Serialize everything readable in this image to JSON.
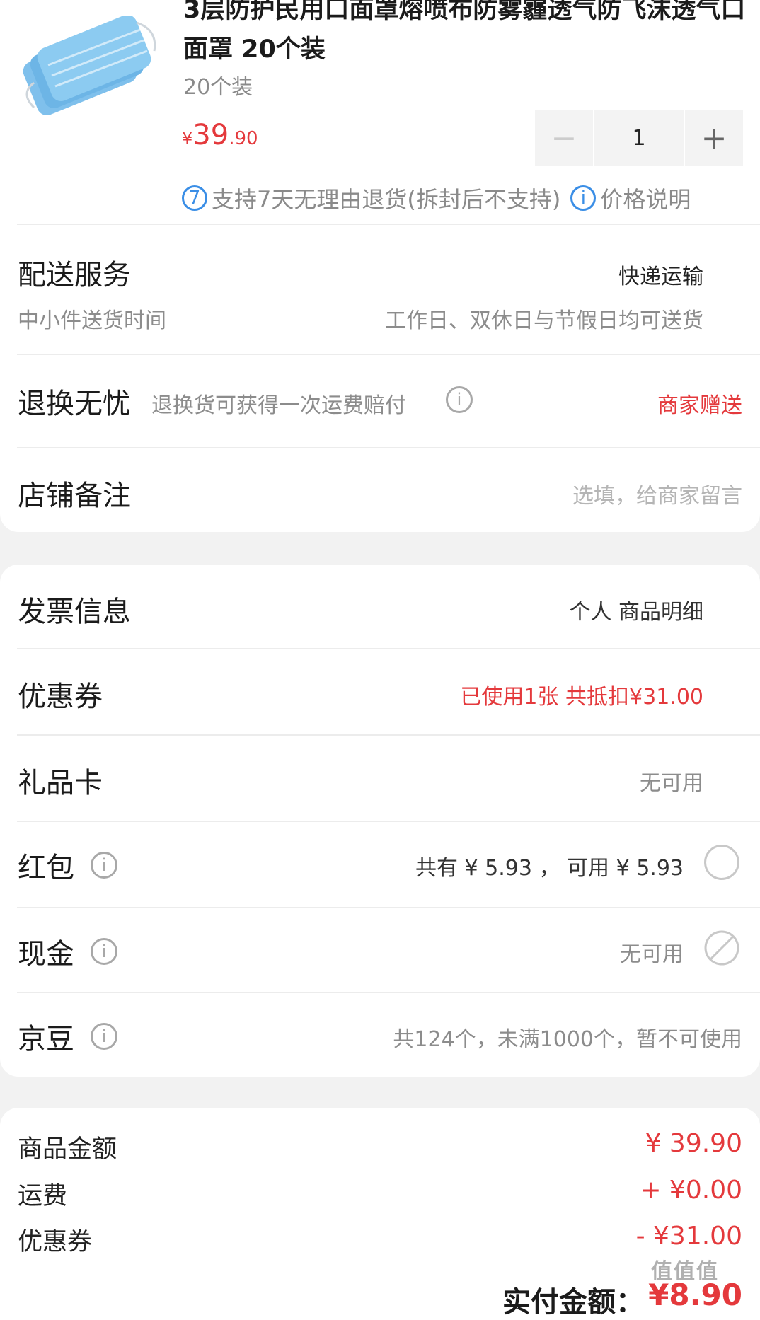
{
  "product": {
    "title": "3层防护民用口面罩熔喷布防雾霾透气防飞沫透气口面罩 20个装",
    "spec": "20个装",
    "price_yen": "¥",
    "price_int": "39",
    "price_dec": ".90",
    "quantity": "1",
    "minus_symbol": "−",
    "plus_symbol": "+",
    "return_badge_num": "7",
    "return_text": "支持7天无理由退货(拆封后不支持)",
    "price_note_icon": "i",
    "price_note": "价格说明"
  },
  "delivery": {
    "title": "配送服务",
    "method": "快递运输",
    "time_label": "中小件送货时间",
    "time_value": "工作日、双休日与节假日均可送货"
  },
  "return_worry": {
    "title": "退换无忧",
    "desc": "退换货可获得一次运费赔付",
    "value": "商家赠送"
  },
  "store_note": {
    "title": "店铺备注",
    "placeholder": "选填，给商家留言"
  },
  "invoice": {
    "title": "发票信息",
    "value": "个人 商品明细"
  },
  "coupon": {
    "title": "优惠券",
    "value": "已使用1张 共抵扣¥31.00"
  },
  "gift_card": {
    "title": "礼品卡",
    "value": "无可用"
  },
  "red_packet": {
    "title": "红包",
    "value": "共有 ¥ 5.93 ， 可用 ¥ 5.93"
  },
  "cash": {
    "title": "现金",
    "value": "无可用"
  },
  "jd_beans": {
    "title": "京豆",
    "value": "共124个，未满1000个，暂不可使用"
  },
  "summary": {
    "goods_label": "商品金额",
    "goods_value": "¥ 39.90",
    "shipping_label": "运费",
    "shipping_value": "+ ¥0.00",
    "coupon_label": "优惠券",
    "coupon_value": "- ¥31.00",
    "paid_label": "实付金额：",
    "paid_value": "¥8.90"
  },
  "watermark": "值值值",
  "colors": {
    "accent_red": "#e4393c",
    "info_blue": "#3a8ee6"
  }
}
